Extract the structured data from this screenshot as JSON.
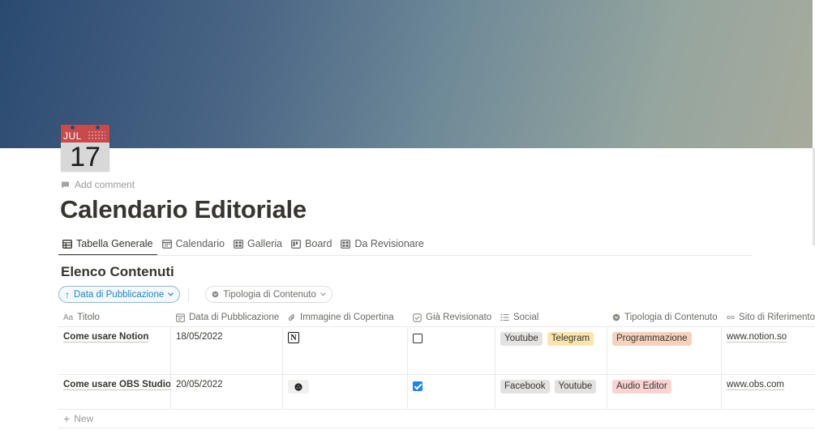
{
  "calendar_icon": {
    "month": "JUL",
    "day": "17"
  },
  "add_comment": "Add comment",
  "page_title": "Calendario Editoriale",
  "tabs": [
    {
      "label": "Tabella Generale",
      "icon": "table-icon"
    },
    {
      "label": "Calendario",
      "icon": "calendar-view-icon"
    },
    {
      "label": "Galleria",
      "icon": "gallery-icon"
    },
    {
      "label": "Board",
      "icon": "board-icon"
    },
    {
      "label": "Da Revisionare",
      "icon": "gallery-icon"
    }
  ],
  "section_title": "Elenco Contenuti",
  "filters": {
    "sort": "Data di Pubblicazione",
    "filter": "Tipologia di Contenuto"
  },
  "columns": [
    {
      "label": "Titolo",
      "icon": "text-property-icon"
    },
    {
      "label": "Data di Pubblicazione",
      "icon": "date-property-icon"
    },
    {
      "label": "Immagine di Copertina",
      "icon": "attachment-icon"
    },
    {
      "label": "Già Revisionato",
      "icon": "checkbox-property-icon"
    },
    {
      "label": "Social",
      "icon": "multi-select-icon"
    },
    {
      "label": "Tipologia di Contenuto",
      "icon": "select-property-icon"
    },
    {
      "label": "Sito di Riferimento",
      "icon": "url-property-icon"
    }
  ],
  "rows": [
    {
      "title": "Come usare Notion",
      "date": "18/05/2022",
      "image": "notion-logo-icon",
      "reviewed": false,
      "social": [
        "Youtube",
        "Telegram"
      ],
      "type": "Programmazione",
      "site": "www.notion.so"
    },
    {
      "title": "Come usare OBS Studio",
      "date": "20/05/2022",
      "image": "obs-logo-icon",
      "reviewed": true,
      "social": [
        "Facebook",
        "Youtube"
      ],
      "type": "Audio Editor",
      "site": "www.obs.com"
    }
  ],
  "new_row_label": "New",
  "colors": {
    "accent_blue": "#2383e2",
    "tag_gray": "#e3e2e0",
    "tag_yellow": "#fbe5ae",
    "tag_orange": "#f6d2bd",
    "tag_red": "#fbd3d3"
  }
}
